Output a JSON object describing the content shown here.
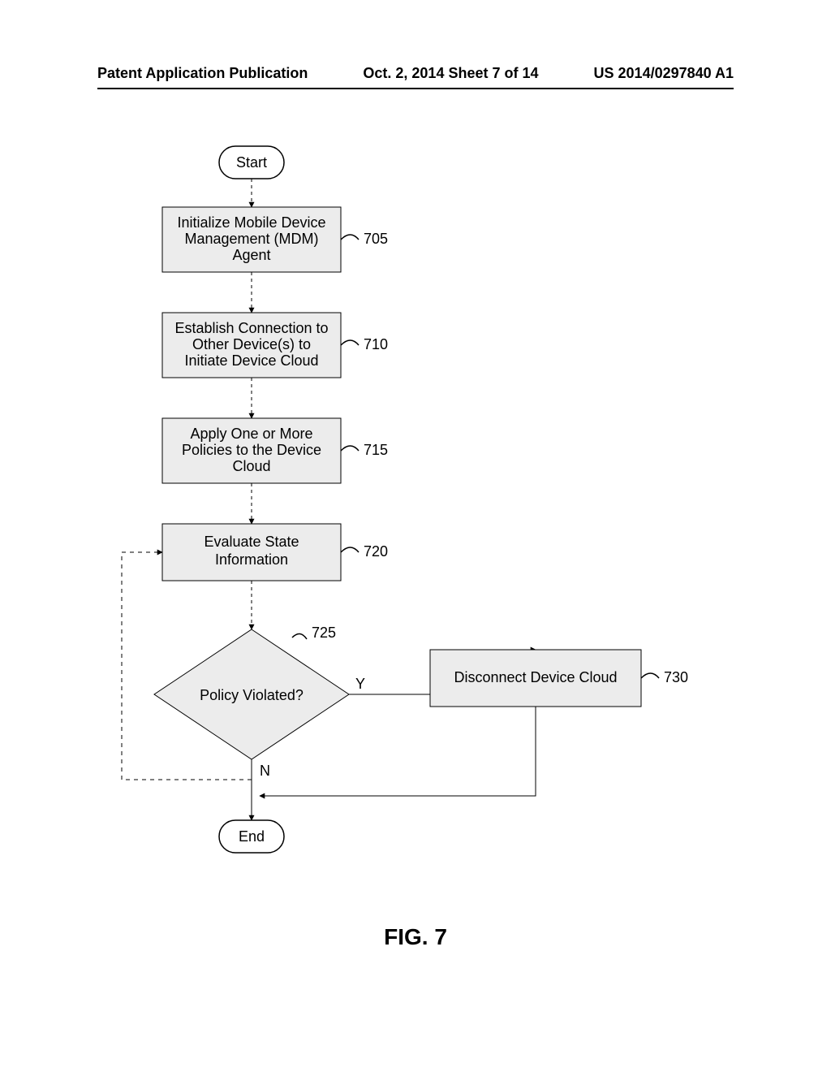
{
  "header": {
    "left": "Patent Application Publication",
    "center": "Oct. 2, 2014  Sheet 7 of 14",
    "right": "US 2014/0297840 A1"
  },
  "figure_label": "FIG. 7",
  "nodes": {
    "start": "Start",
    "end": "End",
    "n705": {
      "l1": "Initialize Mobile Device",
      "l2": "Management (MDM)",
      "l3": "Agent",
      "ref": "705"
    },
    "n710": {
      "l1": "Establish Connection to",
      "l2": "Other Device(s) to",
      "l3": "Initiate Device Cloud",
      "ref": "710"
    },
    "n715": {
      "l1": "Apply One or More",
      "l2": "Policies to the Device",
      "l3": "Cloud",
      "ref": "715"
    },
    "n720": {
      "l1": "Evaluate State",
      "l2": "Information",
      "ref": "720"
    },
    "d725": {
      "text": "Policy Violated?",
      "ref": "725",
      "yes": "Y",
      "no": "N"
    },
    "n730": {
      "text": "Disconnect Device Cloud",
      "ref": "730"
    }
  }
}
